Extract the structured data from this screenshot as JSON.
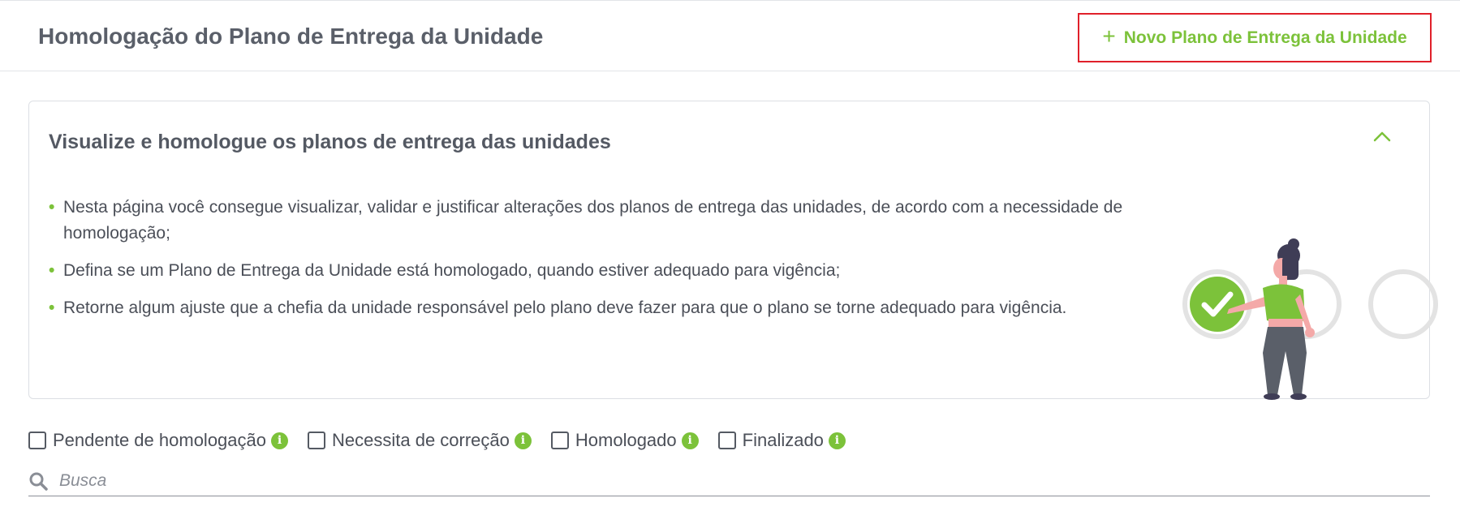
{
  "header": {
    "title": "Homologação do Plano de Entrega da Unidade",
    "new_button_icon": "+",
    "new_button_label": "Novo Plano de Entrega da Unidade"
  },
  "info_card": {
    "title": "Visualize e homologue os planos de entrega das unidades",
    "collapse_icon": "chevron-up-icon",
    "items": [
      "Nesta página você consegue visualizar, validar e justificar alterações dos planos de entrega das unidades, de acordo com a necessidade de homologação;",
      "Defina se um Plano de Entrega da Unidade está homologado, quando estiver adequado para vigência;",
      "Retorne algum ajuste que a chefia da unidade responsável pelo plano deve fazer para que o plano se torne adequado para vigência."
    ],
    "bullet": "•"
  },
  "filters": [
    {
      "label": "Pendente de homologação",
      "checked": false
    },
    {
      "label": "Necessita de correção",
      "checked": false
    },
    {
      "label": "Homologado",
      "checked": false
    },
    {
      "label": "Finalizado",
      "checked": false
    }
  ],
  "info_icon_glyph": "i",
  "search": {
    "placeholder": "Busca",
    "value": ""
  },
  "colors": {
    "accent_green": "#7cc23a",
    "highlight_border": "#e0202a",
    "text": "#4b4f58"
  }
}
